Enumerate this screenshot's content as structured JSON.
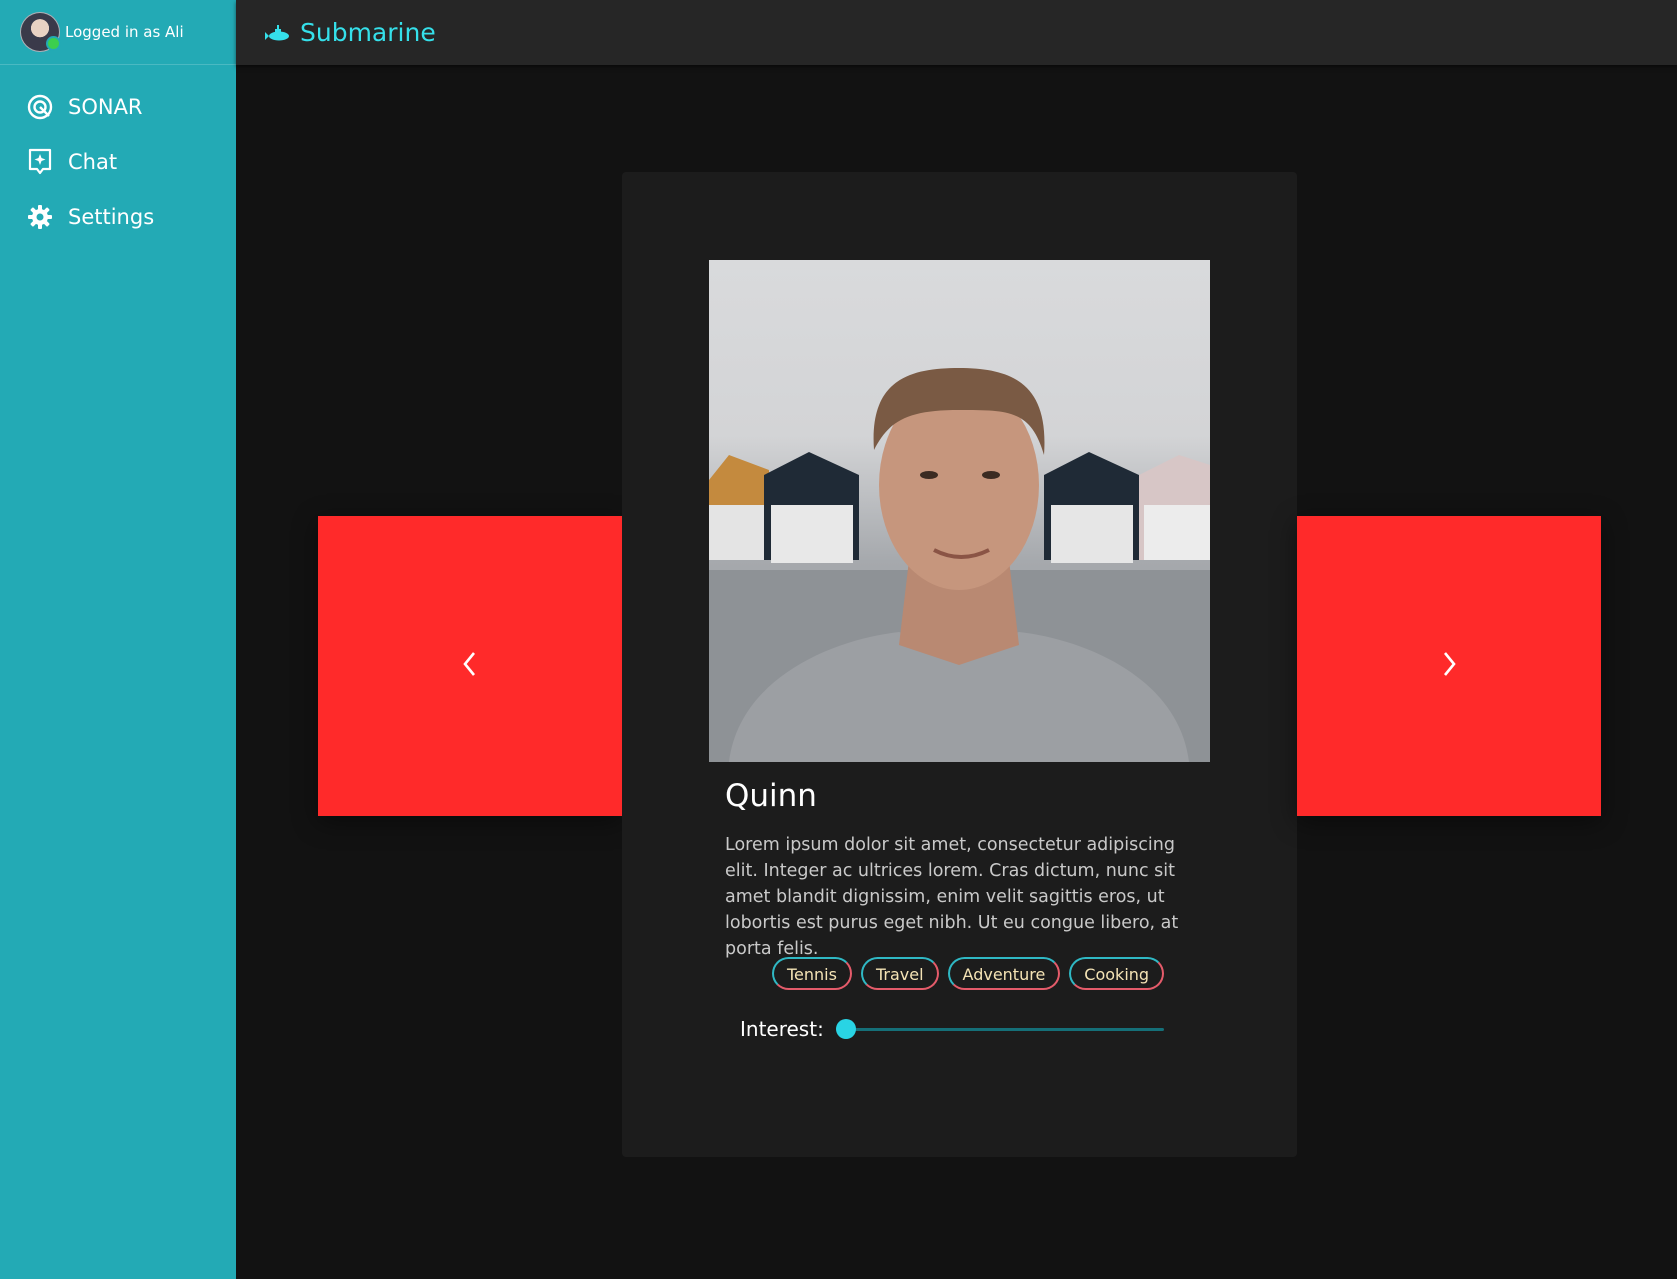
{
  "sidebar": {
    "user_text": "Logged in as Ali",
    "items": [
      {
        "label": "SONAR",
        "icon": "target-icon"
      },
      {
        "label": "Chat",
        "icon": "chat-icon"
      },
      {
        "label": "Settings",
        "icon": "gear-icon"
      }
    ]
  },
  "header": {
    "title": "Submarine",
    "icon": "submarine-icon"
  },
  "profile": {
    "name": "Quinn",
    "bio": "Lorem ipsum dolor sit amet, consectetur adipiscing elit. Integer ac ultrices lorem. Cras dictum, nunc sit amet blandit dignissim, enim velit sagittis eros, ut lobortis est purus eget nibh. Ut eu congue libero, at porta felis.",
    "tags": [
      "Tennis",
      "Travel",
      "Adventure",
      "Cooking"
    ],
    "interest_label": "Interest:",
    "interest_value": 0
  },
  "controls": {
    "prev_icon": "chevron-left-icon",
    "next_icon": "chevron-right-icon"
  },
  "colors": {
    "sidebar_bg": "#23aab5",
    "accent": "#35e0ea",
    "nav_button": "#ff2a2a",
    "background": "#121212",
    "card": "#1c1c1c"
  }
}
